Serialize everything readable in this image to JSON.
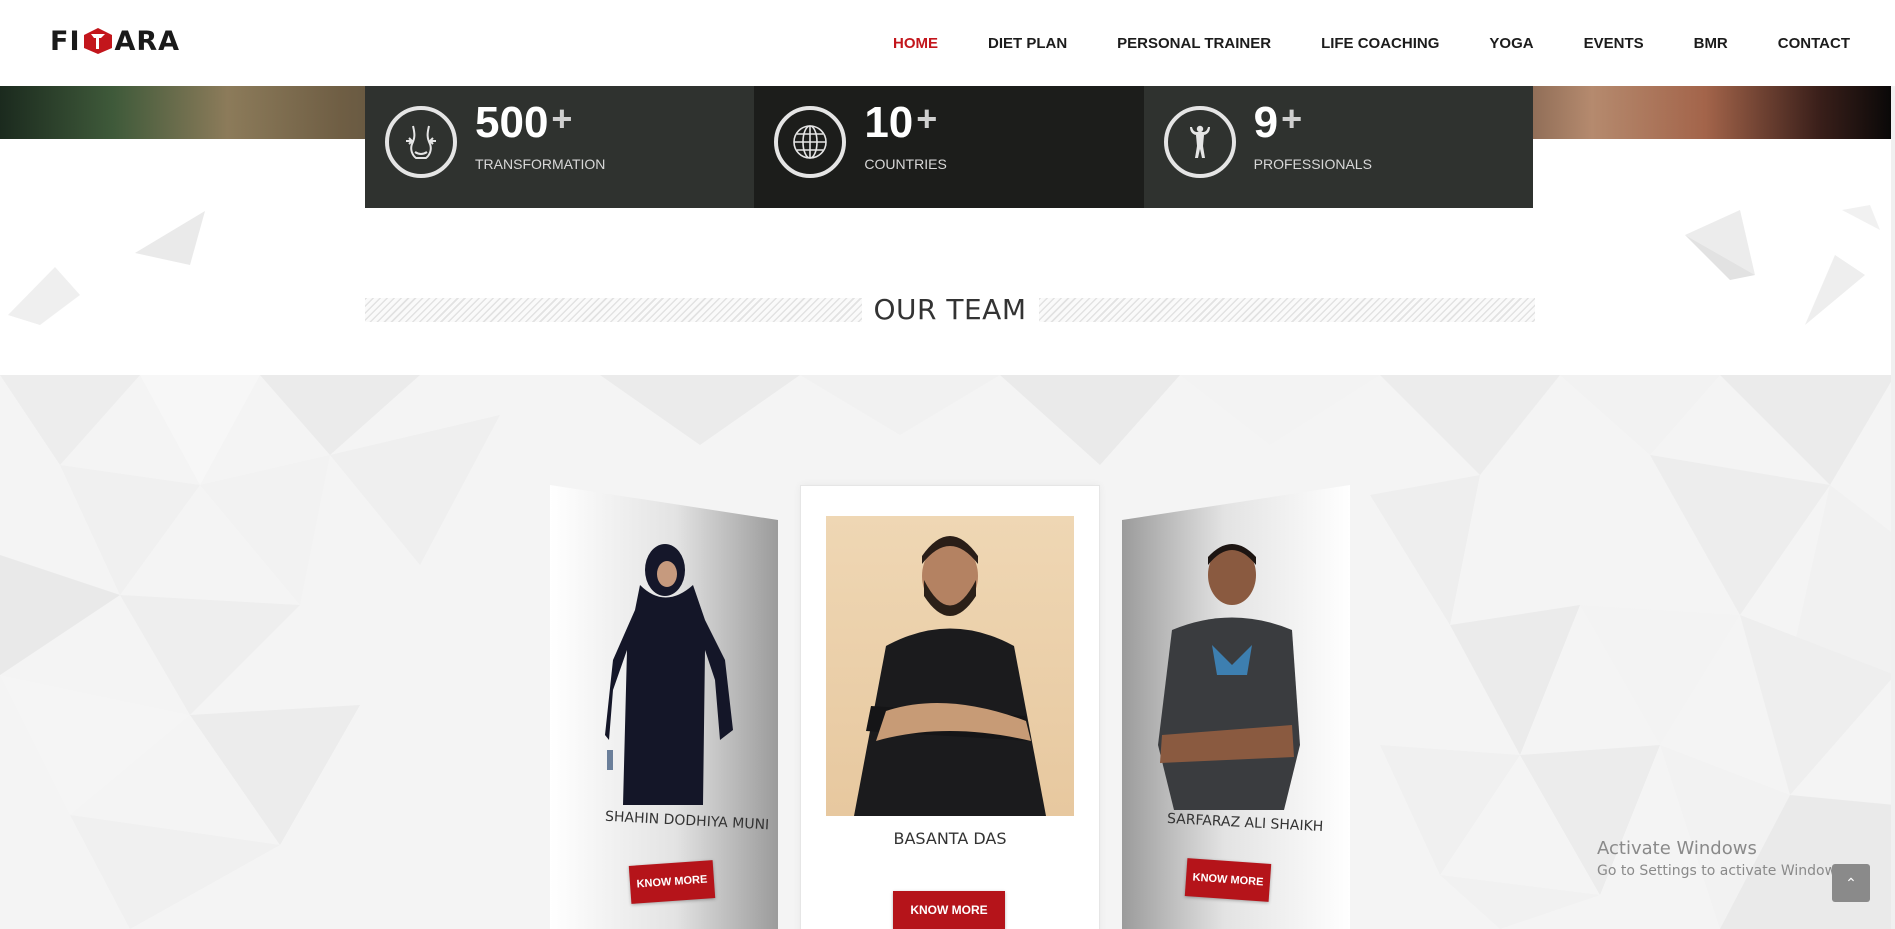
{
  "header": {
    "logo_text": "FITARA",
    "nav": [
      {
        "label": "HOME",
        "active": true
      },
      {
        "label": "DIET PLAN",
        "active": false
      },
      {
        "label": "PERSONAL TRAINER",
        "active": false
      },
      {
        "label": "LIFE COACHING",
        "active": false
      },
      {
        "label": "YOGA",
        "active": false
      },
      {
        "label": "EVENTS",
        "active": false
      },
      {
        "label": "BMR",
        "active": false
      },
      {
        "label": "CONTACT",
        "active": false
      }
    ]
  },
  "stats": [
    {
      "number": "500",
      "suffix": "+",
      "label": "TRANSFORMATION",
      "icon": "waist-icon"
    },
    {
      "number": "10",
      "suffix": "+",
      "label": "COUNTRIES",
      "icon": "globe-icon"
    },
    {
      "number": "9",
      "suffix": "+",
      "label": "PROFESSIONALS",
      "icon": "bodybuilder-icon"
    }
  ],
  "team": {
    "title": "OUR TEAM",
    "members": [
      {
        "name": "SHAHIN DODHIYA MUNI",
        "button": "KNOW MORE"
      },
      {
        "name": "BASANTA DAS",
        "button": "KNOW MORE"
      },
      {
        "name": "SARFARAZ ALI SHAIKH",
        "button": "KNOW MORE"
      }
    ]
  },
  "watermark": {
    "line1": "Activate Windows",
    "line2": "Go to Settings to activate Windows."
  },
  "colors": {
    "accent": "#c3161c",
    "stat_bg": "#2f322f",
    "stat_bg_mid": "#1c1d1b",
    "button": "#b5141a"
  }
}
